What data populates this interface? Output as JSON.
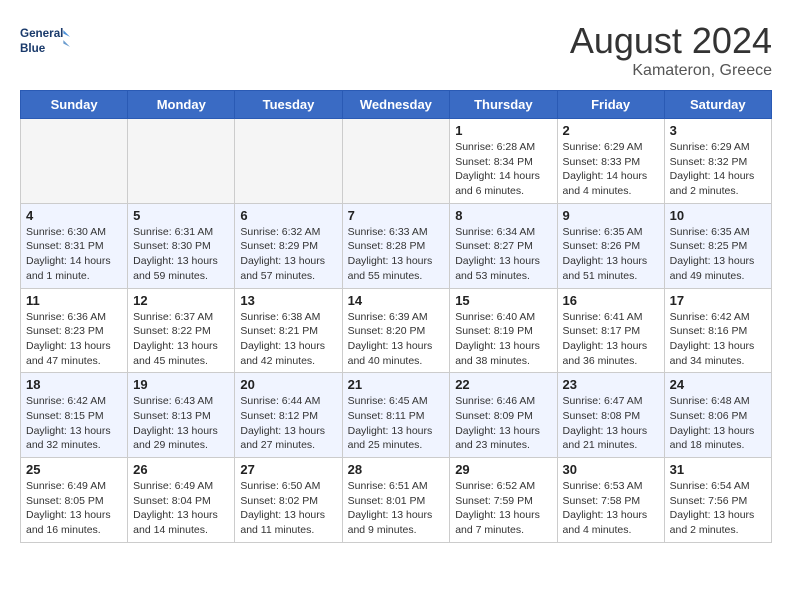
{
  "header": {
    "logo_line1": "General",
    "logo_line2": "Blue",
    "month_year": "August 2024",
    "location": "Kamateron, Greece"
  },
  "weekdays": [
    "Sunday",
    "Monday",
    "Tuesday",
    "Wednesday",
    "Thursday",
    "Friday",
    "Saturday"
  ],
  "weeks": [
    {
      "row_class": "row-white",
      "days": [
        {
          "num": "",
          "info": "",
          "empty": true
        },
        {
          "num": "",
          "info": "",
          "empty": true
        },
        {
          "num": "",
          "info": "",
          "empty": true
        },
        {
          "num": "",
          "info": "",
          "empty": true
        },
        {
          "num": "1",
          "info": "Sunrise: 6:28 AM\nSunset: 8:34 PM\nDaylight: 14 hours\nand 6 minutes.",
          "empty": false
        },
        {
          "num": "2",
          "info": "Sunrise: 6:29 AM\nSunset: 8:33 PM\nDaylight: 14 hours\nand 4 minutes.",
          "empty": false
        },
        {
          "num": "3",
          "info": "Sunrise: 6:29 AM\nSunset: 8:32 PM\nDaylight: 14 hours\nand 2 minutes.",
          "empty": false
        }
      ]
    },
    {
      "row_class": "row-blue",
      "days": [
        {
          "num": "4",
          "info": "Sunrise: 6:30 AM\nSunset: 8:31 PM\nDaylight: 14 hours\nand 1 minute.",
          "empty": false
        },
        {
          "num": "5",
          "info": "Sunrise: 6:31 AM\nSunset: 8:30 PM\nDaylight: 13 hours\nand 59 minutes.",
          "empty": false
        },
        {
          "num": "6",
          "info": "Sunrise: 6:32 AM\nSunset: 8:29 PM\nDaylight: 13 hours\nand 57 minutes.",
          "empty": false
        },
        {
          "num": "7",
          "info": "Sunrise: 6:33 AM\nSunset: 8:28 PM\nDaylight: 13 hours\nand 55 minutes.",
          "empty": false
        },
        {
          "num": "8",
          "info": "Sunrise: 6:34 AM\nSunset: 8:27 PM\nDaylight: 13 hours\nand 53 minutes.",
          "empty": false
        },
        {
          "num": "9",
          "info": "Sunrise: 6:35 AM\nSunset: 8:26 PM\nDaylight: 13 hours\nand 51 minutes.",
          "empty": false
        },
        {
          "num": "10",
          "info": "Sunrise: 6:35 AM\nSunset: 8:25 PM\nDaylight: 13 hours\nand 49 minutes.",
          "empty": false
        }
      ]
    },
    {
      "row_class": "row-white",
      "days": [
        {
          "num": "11",
          "info": "Sunrise: 6:36 AM\nSunset: 8:23 PM\nDaylight: 13 hours\nand 47 minutes.",
          "empty": false
        },
        {
          "num": "12",
          "info": "Sunrise: 6:37 AM\nSunset: 8:22 PM\nDaylight: 13 hours\nand 45 minutes.",
          "empty": false
        },
        {
          "num": "13",
          "info": "Sunrise: 6:38 AM\nSunset: 8:21 PM\nDaylight: 13 hours\nand 42 minutes.",
          "empty": false
        },
        {
          "num": "14",
          "info": "Sunrise: 6:39 AM\nSunset: 8:20 PM\nDaylight: 13 hours\nand 40 minutes.",
          "empty": false
        },
        {
          "num": "15",
          "info": "Sunrise: 6:40 AM\nSunset: 8:19 PM\nDaylight: 13 hours\nand 38 minutes.",
          "empty": false
        },
        {
          "num": "16",
          "info": "Sunrise: 6:41 AM\nSunset: 8:17 PM\nDaylight: 13 hours\nand 36 minutes.",
          "empty": false
        },
        {
          "num": "17",
          "info": "Sunrise: 6:42 AM\nSunset: 8:16 PM\nDaylight: 13 hours\nand 34 minutes.",
          "empty": false
        }
      ]
    },
    {
      "row_class": "row-blue",
      "days": [
        {
          "num": "18",
          "info": "Sunrise: 6:42 AM\nSunset: 8:15 PM\nDaylight: 13 hours\nand 32 minutes.",
          "empty": false
        },
        {
          "num": "19",
          "info": "Sunrise: 6:43 AM\nSunset: 8:13 PM\nDaylight: 13 hours\nand 29 minutes.",
          "empty": false
        },
        {
          "num": "20",
          "info": "Sunrise: 6:44 AM\nSunset: 8:12 PM\nDaylight: 13 hours\nand 27 minutes.",
          "empty": false
        },
        {
          "num": "21",
          "info": "Sunrise: 6:45 AM\nSunset: 8:11 PM\nDaylight: 13 hours\nand 25 minutes.",
          "empty": false
        },
        {
          "num": "22",
          "info": "Sunrise: 6:46 AM\nSunset: 8:09 PM\nDaylight: 13 hours\nand 23 minutes.",
          "empty": false
        },
        {
          "num": "23",
          "info": "Sunrise: 6:47 AM\nSunset: 8:08 PM\nDaylight: 13 hours\nand 21 minutes.",
          "empty": false
        },
        {
          "num": "24",
          "info": "Sunrise: 6:48 AM\nSunset: 8:06 PM\nDaylight: 13 hours\nand 18 minutes.",
          "empty": false
        }
      ]
    },
    {
      "row_class": "row-white",
      "days": [
        {
          "num": "25",
          "info": "Sunrise: 6:49 AM\nSunset: 8:05 PM\nDaylight: 13 hours\nand 16 minutes.",
          "empty": false
        },
        {
          "num": "26",
          "info": "Sunrise: 6:49 AM\nSunset: 8:04 PM\nDaylight: 13 hours\nand 14 minutes.",
          "empty": false
        },
        {
          "num": "27",
          "info": "Sunrise: 6:50 AM\nSunset: 8:02 PM\nDaylight: 13 hours\nand 11 minutes.",
          "empty": false
        },
        {
          "num": "28",
          "info": "Sunrise: 6:51 AM\nSunset: 8:01 PM\nDaylight: 13 hours\nand 9 minutes.",
          "empty": false
        },
        {
          "num": "29",
          "info": "Sunrise: 6:52 AM\nSunset: 7:59 PM\nDaylight: 13 hours\nand 7 minutes.",
          "empty": false
        },
        {
          "num": "30",
          "info": "Sunrise: 6:53 AM\nSunset: 7:58 PM\nDaylight: 13 hours\nand 4 minutes.",
          "empty": false
        },
        {
          "num": "31",
          "info": "Sunrise: 6:54 AM\nSunset: 7:56 PM\nDaylight: 13 hours\nand 2 minutes.",
          "empty": false
        }
      ]
    }
  ]
}
